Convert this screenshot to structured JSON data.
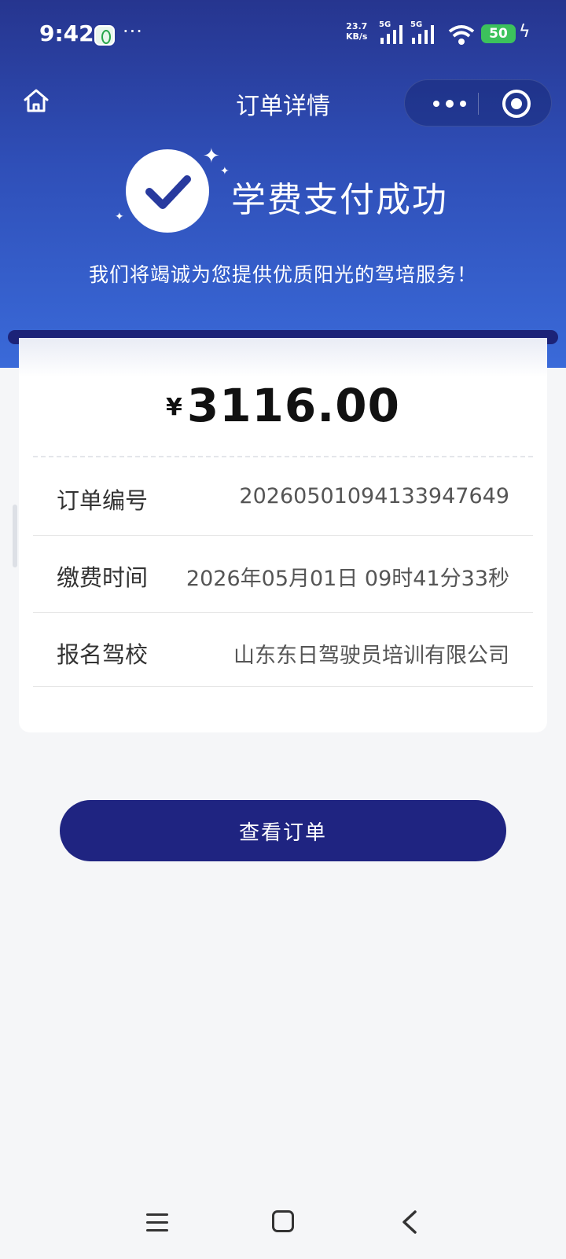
{
  "status_bar": {
    "time": "9:42",
    "more": "···",
    "net_speed_value": "23.7",
    "net_speed_unit": "KB/s",
    "sim1_label": "5G",
    "sim2_label": "5G",
    "battery": "50",
    "icons": [
      "app-icon",
      "signal-icon",
      "wifi-icon",
      "battery-icon",
      "charging-icon"
    ]
  },
  "nav": {
    "title": "订单详情",
    "home_icon": "home-icon",
    "more_icon": "more-icon",
    "close_icon": "target-close-icon"
  },
  "success": {
    "icon": "check-circle-icon",
    "title": "学费支付成功",
    "subtitle": "我们将竭诚为您提供优质阳光的驾培服务！"
  },
  "order": {
    "currency": "¥",
    "amount": "3116.00",
    "rows": [
      {
        "label": "订单编号",
        "value": "20260501094133947649"
      },
      {
        "label": "缴费时间",
        "value": "2026年05月01日 09时41分33秒"
      },
      {
        "label": "报名驾校",
        "value": "山东东日驾驶员培训有限公司"
      }
    ]
  },
  "actions": {
    "view_order": "查看订单"
  },
  "colors": {
    "hero_top": "#26358f",
    "hero_bottom": "#3a6ad9",
    "button": "#1f2481",
    "page_bg": "#f5f6f8"
  }
}
